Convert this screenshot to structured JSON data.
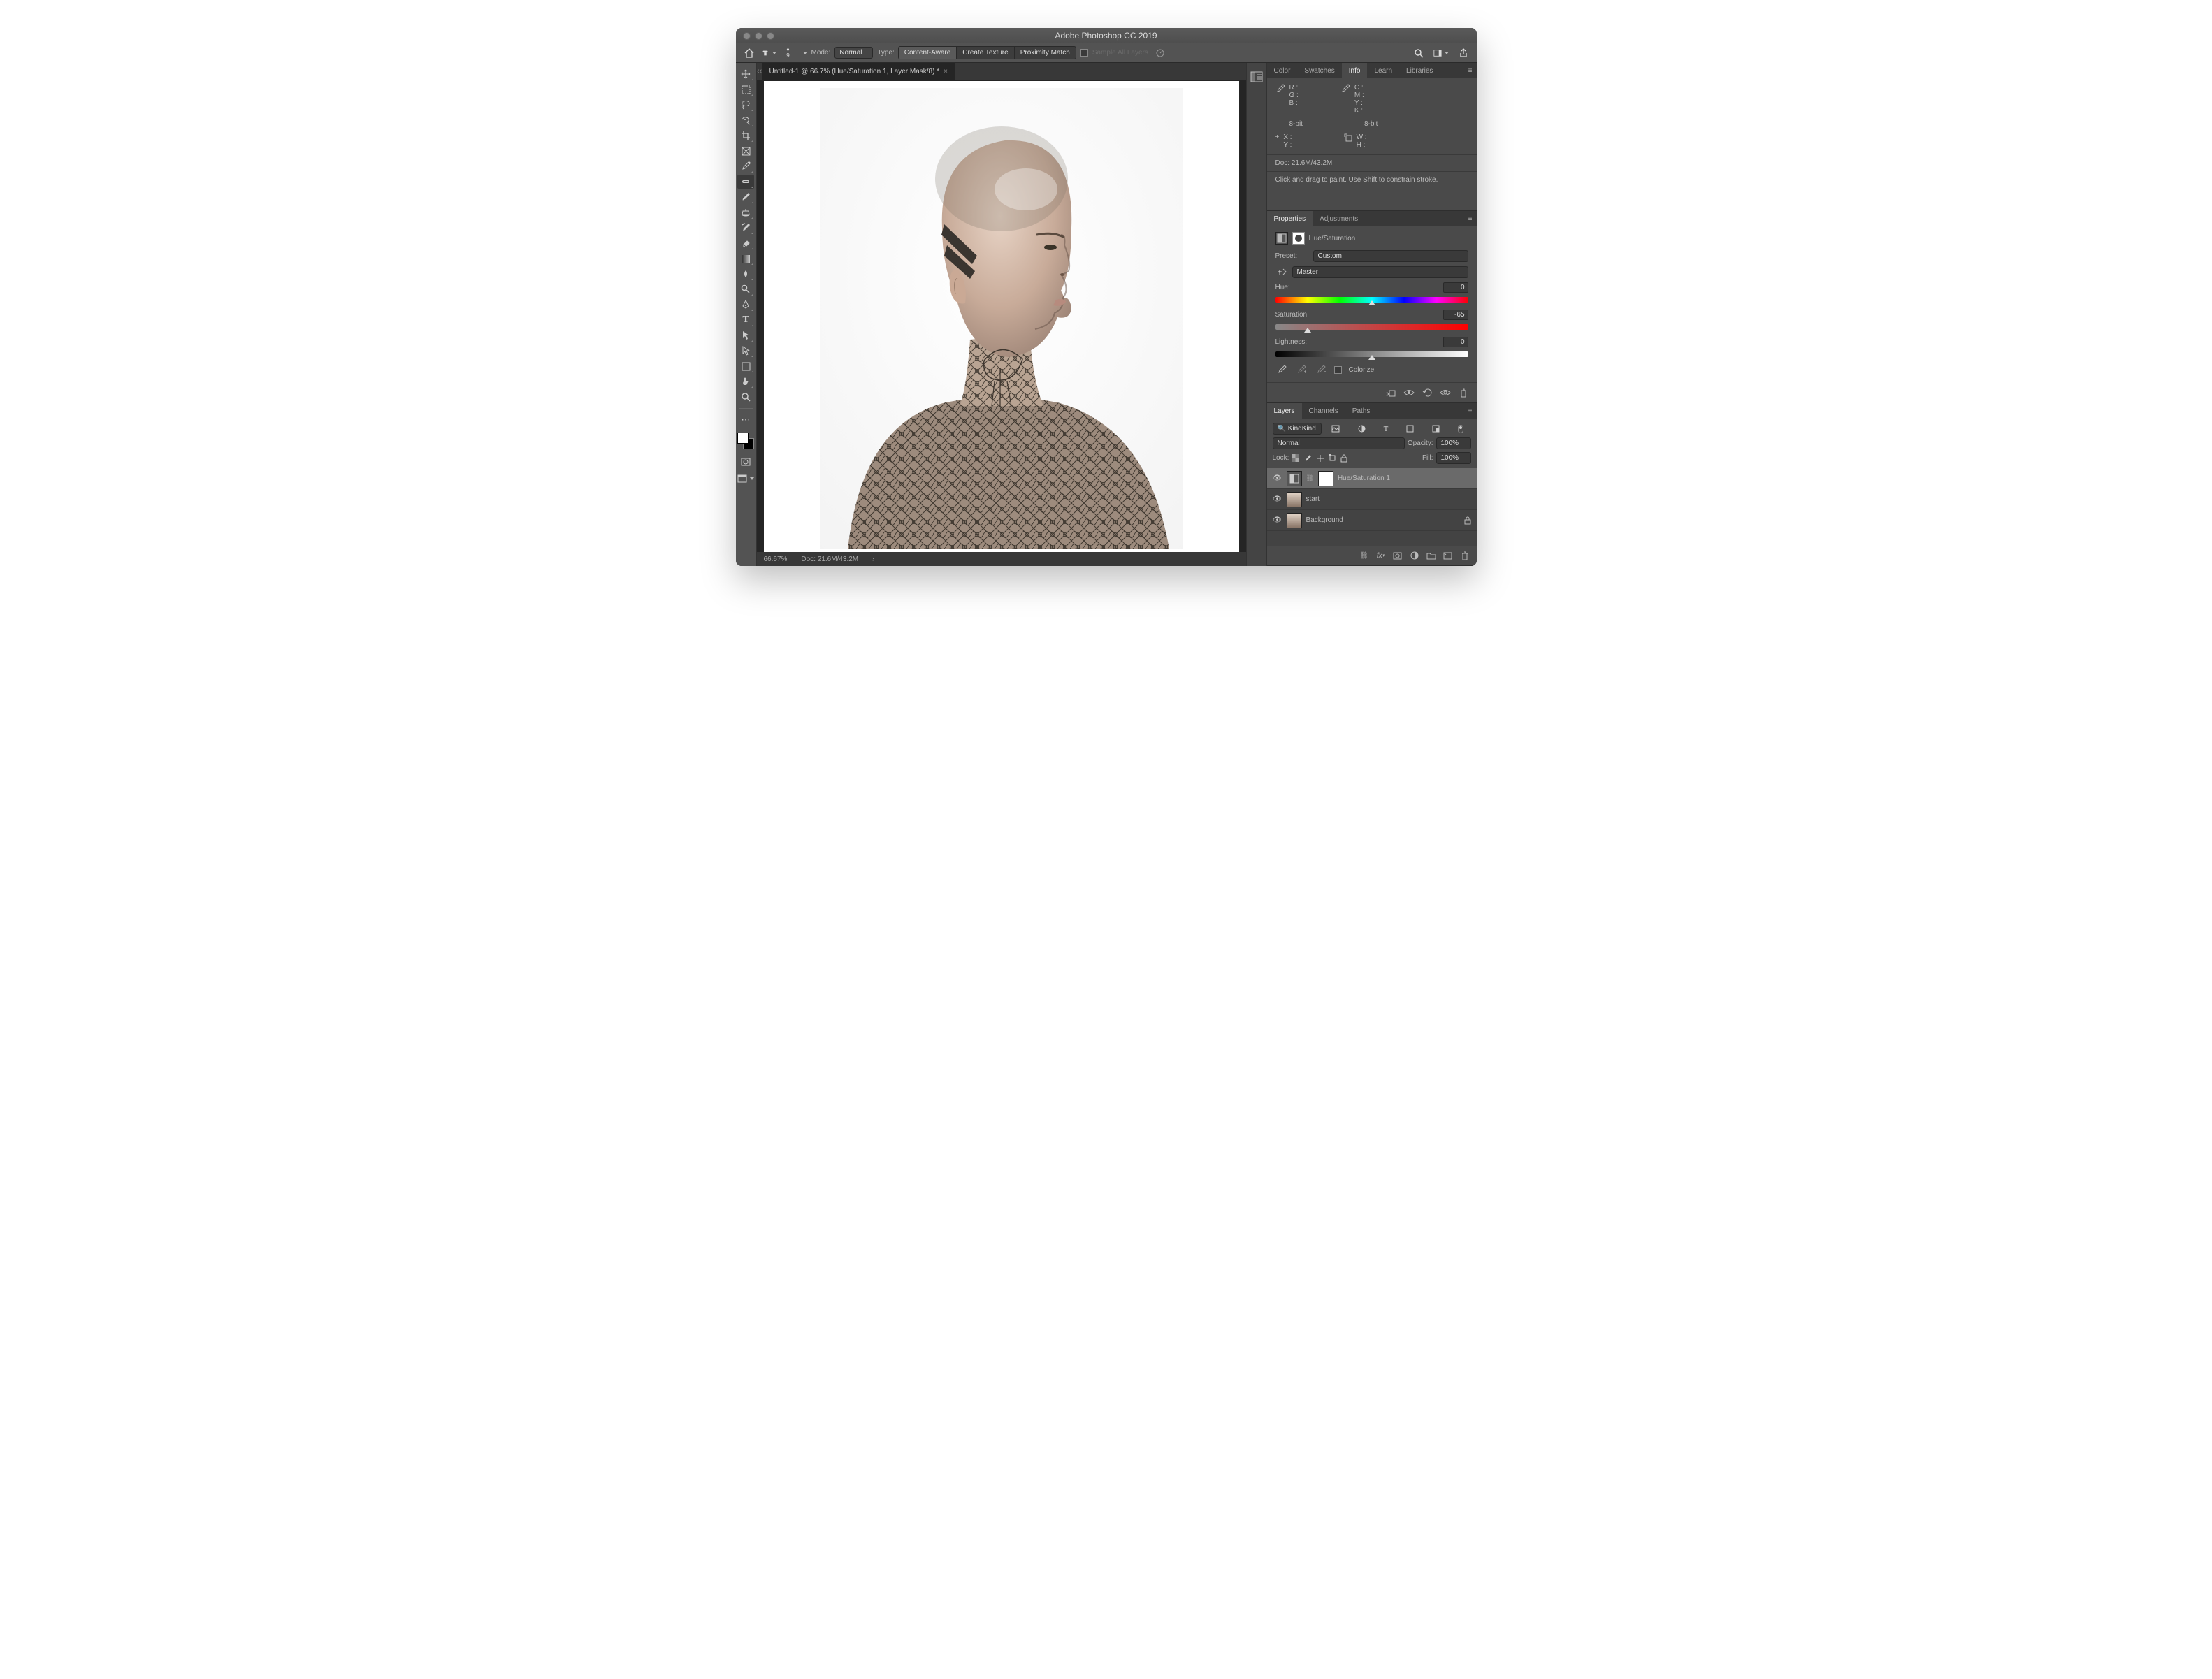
{
  "titlebar": {
    "title": "Adobe Photoshop CC 2019"
  },
  "optionsbar": {
    "brush_size": "9",
    "mode_label": "Mode:",
    "mode_value": "Normal",
    "type_label": "Type:",
    "type_options": [
      "Content-Aware",
      "Create Texture",
      "Proximity Match"
    ],
    "sample_all_layers": "Sample All Layers"
  },
  "document_tab": "Untitled-1 @ 66.7% (Hue/Saturation 1, Layer Mask/8) *",
  "statusbar": {
    "zoom": "66.67%",
    "doc": "Doc: 21.6M/43.2M"
  },
  "info_panel": {
    "tabs": [
      "Color",
      "Swatches",
      "Info",
      "Learn",
      "Libraries"
    ],
    "active_tab": "Info",
    "rgb_labels": "R :\nG :\nB :",
    "cmyk_labels": "C :\nM :\nY :\nK :",
    "bit_depth": "8-bit",
    "xy_labels": "X :\nY :",
    "wh_labels": "W :\nH :",
    "doc_size": "Doc: 21.6M/43.2M",
    "hint": "Click and drag to paint. Use Shift to constrain stroke."
  },
  "properties_panel": {
    "tabs": [
      "Properties",
      "Adjustments"
    ],
    "active_tab": "Properties",
    "adj_type": "Hue/Saturation",
    "preset_label": "Preset:",
    "preset_value": "Custom",
    "range_value": "Master",
    "hue": {
      "label": "Hue:",
      "value": "0",
      "pos": 50
    },
    "saturation": {
      "label": "Saturation:",
      "value": "-65",
      "pos": 17
    },
    "lightness": {
      "label": "Lightness:",
      "value": "0",
      "pos": 50
    },
    "colorize": "Colorize"
  },
  "layers_panel": {
    "tabs": [
      "Layers",
      "Channels",
      "Paths"
    ],
    "active_tab": "Layers",
    "filter": "Kind",
    "blend_mode": "Normal",
    "opacity_label": "Opacity:",
    "opacity": "100%",
    "lock_label": "Lock:",
    "fill_label": "Fill:",
    "fill": "100%",
    "layers": [
      {
        "name": "Hue/Saturation 1",
        "type": "adjustment",
        "selected": true
      },
      {
        "name": "start",
        "type": "bitmap",
        "selected": false
      },
      {
        "name": "Background",
        "type": "bitmap",
        "selected": false,
        "locked": true
      }
    ]
  },
  "tools": [
    "move",
    "marquee",
    "lasso",
    "magic-wand",
    "crop",
    "frame",
    "eyedropper",
    "healing-brush",
    "brush",
    "clone-stamp",
    "history-brush",
    "eraser",
    "gradient",
    "blur",
    "dodge",
    "pen",
    "type",
    "path-select",
    "direct-select",
    "rectangle",
    "hand",
    "zoom"
  ]
}
